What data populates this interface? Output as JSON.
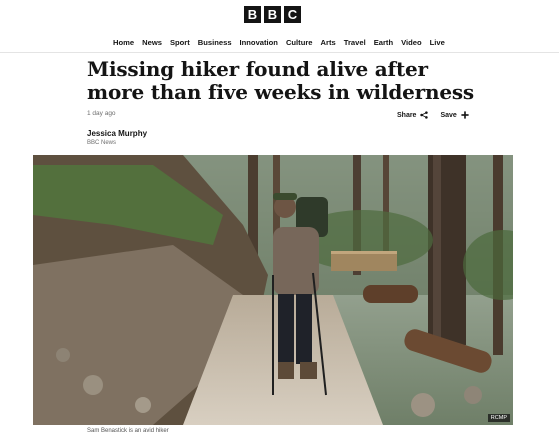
{
  "brand": {
    "logo_letters": [
      "B",
      "B",
      "C"
    ]
  },
  "nav": {
    "items": [
      "Home",
      "News",
      "Sport",
      "Business",
      "Innovation",
      "Culture",
      "Arts",
      "Travel",
      "Earth",
      "Video",
      "Live"
    ]
  },
  "article": {
    "headline": "Missing hiker found alive after more than five weeks in wilderness",
    "timestamp": "1 day ago",
    "share_label": "Share",
    "save_label": "Save",
    "author": "Jessica Murphy",
    "source": "BBC News",
    "image": {
      "caption": "Sam Benastick is an avid hiker",
      "credit": "RCMP"
    }
  },
  "icons": {
    "share": "share-icon",
    "save": "plus-icon"
  }
}
